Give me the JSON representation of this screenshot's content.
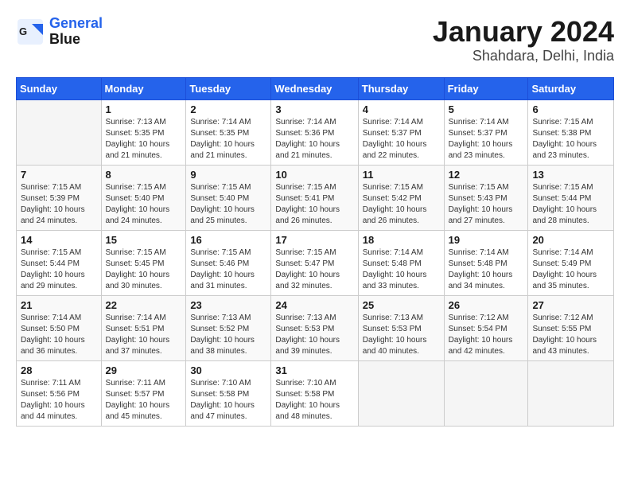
{
  "header": {
    "logo": {
      "line1": "General",
      "line2": "Blue"
    },
    "title": "January 2024",
    "location": "Shahdara, Delhi, India"
  },
  "weekdays": [
    "Sunday",
    "Monday",
    "Tuesday",
    "Wednesday",
    "Thursday",
    "Friday",
    "Saturday"
  ],
  "weeks": [
    [
      {
        "day": "",
        "sunrise": "",
        "sunset": "",
        "daylight": ""
      },
      {
        "day": "1",
        "sunrise": "Sunrise: 7:13 AM",
        "sunset": "Sunset: 5:35 PM",
        "daylight": "Daylight: 10 hours and 21 minutes."
      },
      {
        "day": "2",
        "sunrise": "Sunrise: 7:14 AM",
        "sunset": "Sunset: 5:35 PM",
        "daylight": "Daylight: 10 hours and 21 minutes."
      },
      {
        "day": "3",
        "sunrise": "Sunrise: 7:14 AM",
        "sunset": "Sunset: 5:36 PM",
        "daylight": "Daylight: 10 hours and 21 minutes."
      },
      {
        "day": "4",
        "sunrise": "Sunrise: 7:14 AM",
        "sunset": "Sunset: 5:37 PM",
        "daylight": "Daylight: 10 hours and 22 minutes."
      },
      {
        "day": "5",
        "sunrise": "Sunrise: 7:14 AM",
        "sunset": "Sunset: 5:37 PM",
        "daylight": "Daylight: 10 hours and 23 minutes."
      },
      {
        "day": "6",
        "sunrise": "Sunrise: 7:15 AM",
        "sunset": "Sunset: 5:38 PM",
        "daylight": "Daylight: 10 hours and 23 minutes."
      }
    ],
    [
      {
        "day": "7",
        "sunrise": "Sunrise: 7:15 AM",
        "sunset": "Sunset: 5:39 PM",
        "daylight": "Daylight: 10 hours and 24 minutes."
      },
      {
        "day": "8",
        "sunrise": "Sunrise: 7:15 AM",
        "sunset": "Sunset: 5:40 PM",
        "daylight": "Daylight: 10 hours and 24 minutes."
      },
      {
        "day": "9",
        "sunrise": "Sunrise: 7:15 AM",
        "sunset": "Sunset: 5:40 PM",
        "daylight": "Daylight: 10 hours and 25 minutes."
      },
      {
        "day": "10",
        "sunrise": "Sunrise: 7:15 AM",
        "sunset": "Sunset: 5:41 PM",
        "daylight": "Daylight: 10 hours and 26 minutes."
      },
      {
        "day": "11",
        "sunrise": "Sunrise: 7:15 AM",
        "sunset": "Sunset: 5:42 PM",
        "daylight": "Daylight: 10 hours and 26 minutes."
      },
      {
        "day": "12",
        "sunrise": "Sunrise: 7:15 AM",
        "sunset": "Sunset: 5:43 PM",
        "daylight": "Daylight: 10 hours and 27 minutes."
      },
      {
        "day": "13",
        "sunrise": "Sunrise: 7:15 AM",
        "sunset": "Sunset: 5:44 PM",
        "daylight": "Daylight: 10 hours and 28 minutes."
      }
    ],
    [
      {
        "day": "14",
        "sunrise": "Sunrise: 7:15 AM",
        "sunset": "Sunset: 5:44 PM",
        "daylight": "Daylight: 10 hours and 29 minutes."
      },
      {
        "day": "15",
        "sunrise": "Sunrise: 7:15 AM",
        "sunset": "Sunset: 5:45 PM",
        "daylight": "Daylight: 10 hours and 30 minutes."
      },
      {
        "day": "16",
        "sunrise": "Sunrise: 7:15 AM",
        "sunset": "Sunset: 5:46 PM",
        "daylight": "Daylight: 10 hours and 31 minutes."
      },
      {
        "day": "17",
        "sunrise": "Sunrise: 7:15 AM",
        "sunset": "Sunset: 5:47 PM",
        "daylight": "Daylight: 10 hours and 32 minutes."
      },
      {
        "day": "18",
        "sunrise": "Sunrise: 7:14 AM",
        "sunset": "Sunset: 5:48 PM",
        "daylight": "Daylight: 10 hours and 33 minutes."
      },
      {
        "day": "19",
        "sunrise": "Sunrise: 7:14 AM",
        "sunset": "Sunset: 5:48 PM",
        "daylight": "Daylight: 10 hours and 34 minutes."
      },
      {
        "day": "20",
        "sunrise": "Sunrise: 7:14 AM",
        "sunset": "Sunset: 5:49 PM",
        "daylight": "Daylight: 10 hours and 35 minutes."
      }
    ],
    [
      {
        "day": "21",
        "sunrise": "Sunrise: 7:14 AM",
        "sunset": "Sunset: 5:50 PM",
        "daylight": "Daylight: 10 hours and 36 minutes."
      },
      {
        "day": "22",
        "sunrise": "Sunrise: 7:14 AM",
        "sunset": "Sunset: 5:51 PM",
        "daylight": "Daylight: 10 hours and 37 minutes."
      },
      {
        "day": "23",
        "sunrise": "Sunrise: 7:13 AM",
        "sunset": "Sunset: 5:52 PM",
        "daylight": "Daylight: 10 hours and 38 minutes."
      },
      {
        "day": "24",
        "sunrise": "Sunrise: 7:13 AM",
        "sunset": "Sunset: 5:53 PM",
        "daylight": "Daylight: 10 hours and 39 minutes."
      },
      {
        "day": "25",
        "sunrise": "Sunrise: 7:13 AM",
        "sunset": "Sunset: 5:53 PM",
        "daylight": "Daylight: 10 hours and 40 minutes."
      },
      {
        "day": "26",
        "sunrise": "Sunrise: 7:12 AM",
        "sunset": "Sunset: 5:54 PM",
        "daylight": "Daylight: 10 hours and 42 minutes."
      },
      {
        "day": "27",
        "sunrise": "Sunrise: 7:12 AM",
        "sunset": "Sunset: 5:55 PM",
        "daylight": "Daylight: 10 hours and 43 minutes."
      }
    ],
    [
      {
        "day": "28",
        "sunrise": "Sunrise: 7:11 AM",
        "sunset": "Sunset: 5:56 PM",
        "daylight": "Daylight: 10 hours and 44 minutes."
      },
      {
        "day": "29",
        "sunrise": "Sunrise: 7:11 AM",
        "sunset": "Sunset: 5:57 PM",
        "daylight": "Daylight: 10 hours and 45 minutes."
      },
      {
        "day": "30",
        "sunrise": "Sunrise: 7:10 AM",
        "sunset": "Sunset: 5:58 PM",
        "daylight": "Daylight: 10 hours and 47 minutes."
      },
      {
        "day": "31",
        "sunrise": "Sunrise: 7:10 AM",
        "sunset": "Sunset: 5:58 PM",
        "daylight": "Daylight: 10 hours and 48 minutes."
      },
      {
        "day": "",
        "sunrise": "",
        "sunset": "",
        "daylight": ""
      },
      {
        "day": "",
        "sunrise": "",
        "sunset": "",
        "daylight": ""
      },
      {
        "day": "",
        "sunrise": "",
        "sunset": "",
        "daylight": ""
      }
    ]
  ]
}
